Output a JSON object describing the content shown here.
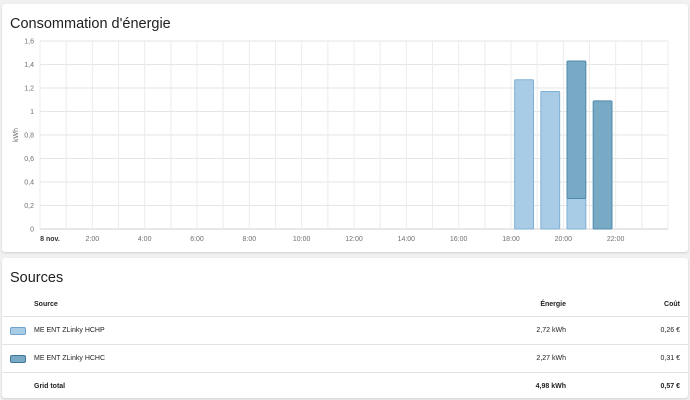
{
  "energy_card": {
    "title": "Consommation d'énergie",
    "y_unit": "kWh"
  },
  "chart_data": {
    "type": "bar",
    "stacked": true,
    "categories": [
      "18:00",
      "19:00",
      "20:00",
      "21:00"
    ],
    "series": [
      {
        "name": "ME ENT ZLinky HCHP",
        "values": [
          1.27,
          1.17,
          0.26,
          0
        ],
        "color": "#a8cbe6",
        "border": "#7fb0d6"
      },
      {
        "name": "ME ENT ZLinky HCHC",
        "values": [
          0,
          0,
          1.17,
          1.09
        ],
        "color": "#78aac6",
        "border": "#4f8aaa"
      }
    ],
    "x_ticks": [
      "8 nov.",
      "2:00",
      "4:00",
      "6:00",
      "8:00",
      "10:00",
      "12:00",
      "14:00",
      "16:00",
      "18:00",
      "20:00",
      "22:00"
    ],
    "x_tick_hours": [
      0,
      2,
      4,
      6,
      8,
      10,
      12,
      14,
      16,
      18,
      20,
      22
    ],
    "bar_hours": [
      18,
      19,
      20,
      21
    ],
    "x_range_hours": [
      0,
      24
    ],
    "y_ticks": [
      "0",
      "0,2",
      "0,4",
      "0,6",
      "0,8",
      "1",
      "1,2",
      "1,4",
      "1,6"
    ],
    "ylim": [
      0,
      1.6
    ],
    "ylabel": "kWh",
    "grid": true
  },
  "sources_card": {
    "title": "Sources",
    "headers": {
      "source": "Source",
      "energy": "Énergie",
      "cost": "Coût"
    },
    "rows": [
      {
        "name": "ME ENT ZLinky HCHP",
        "energy": "2,72 kWh",
        "cost": "0,26 €",
        "color": "#a8cbe6",
        "border": "#6fa3cc"
      },
      {
        "name": "ME ENT ZLinky HCHC",
        "energy": "2,27 kWh",
        "cost": "0,31 €",
        "color": "#78aac6",
        "border": "#3f7696"
      }
    ],
    "total": {
      "label": "Grid total",
      "energy": "4,98 kWh",
      "cost": "0,57 €"
    }
  }
}
